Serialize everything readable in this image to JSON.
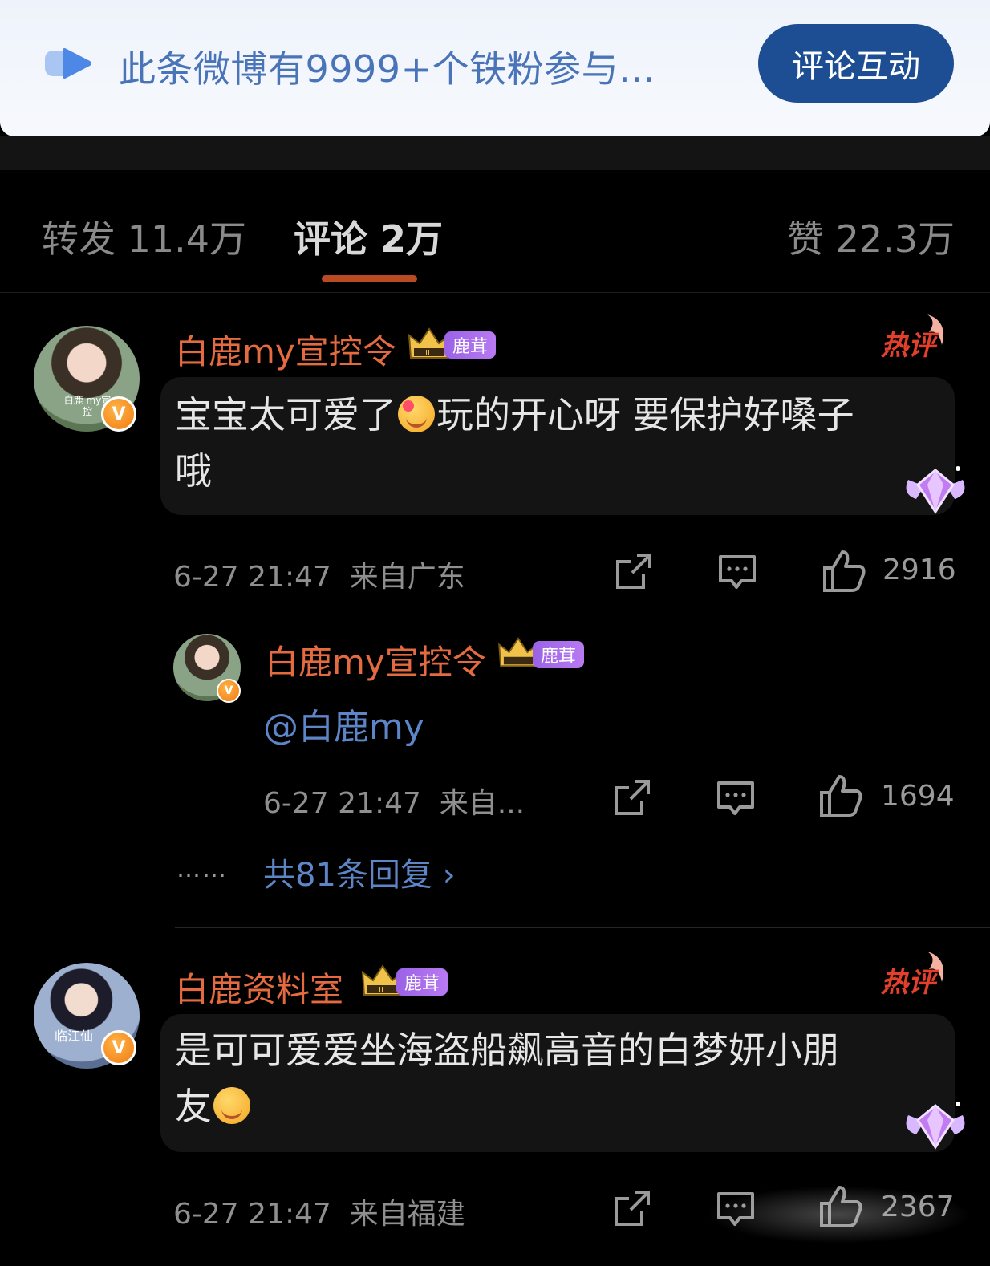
{
  "banner": {
    "text": "此条微博有9999+个铁粉参与...",
    "button_label": "评论互动"
  },
  "tabs": {
    "repost": "转发 11.4万",
    "comments": "评论 2万",
    "likes": "赞 22.3万"
  },
  "comments": [
    {
      "username": "白鹿my宣控令",
      "tag": "鹿茸",
      "hot_badge": "热评",
      "text_before_emoji": "宝宝太可爱了",
      "text_after_emoji": "玩的开心呀 要保护好嗓子",
      "text_line2": "哦",
      "avatar_caption": "白鹿 my宣控",
      "time": "6-27 21:47",
      "location": "来自广东",
      "likes": "2916",
      "reply": {
        "username": "白鹿my宣控令",
        "tag": "鹿茸",
        "mention": "@白鹿my",
        "time": "6-27 21:47",
        "location": "来自...",
        "likes": "1694"
      },
      "ellipsis": "……",
      "more_replies": "共81条回复 ›"
    },
    {
      "username": "白鹿资料室",
      "tag": "鹿茸",
      "hot_badge": "热评",
      "text_line1": "是可可爱爱坐海盗船飙高音的白梦妍小朋",
      "text_line2": "友",
      "avatar_caption": "临江仙",
      "time": "6-27 21:47",
      "location": "来自福建",
      "likes": "2367"
    }
  ],
  "colors": {
    "username": "#e46a3f",
    "link": "#5d86c8",
    "accent_button": "#1d4e93",
    "tab_underline": "#b84a24",
    "tag": "#a56cec"
  },
  "icons": [
    "banner-play-icon",
    "crown-icon",
    "hot-comment-icon",
    "gem-wings-icon",
    "share-icon",
    "comment-icon",
    "thumbs-up-icon",
    "verified-v-icon"
  ]
}
